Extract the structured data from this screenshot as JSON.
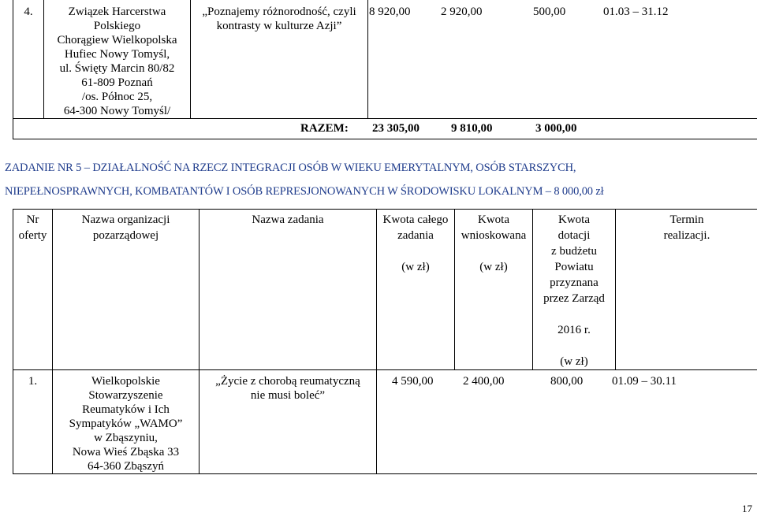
{
  "top_row": {
    "no": "4.",
    "org": "Związek Harcerstwa\nPolskiego\nChorągiew Wielkopolska\nHufiec Nowy Tomyśl,\nul. Święty Marcin 80/82\n61-809 Poznań\n/os. Północ 25,\n64-300 Nowy Tomyśl/",
    "task": "„Poznajemy różnorodność, czyli\nkontrasty w kulturze Azji”",
    "total_cost": "8 920,00",
    "requested": "2 920,00",
    "granted": "500,00",
    "term": "01.03 – 31.12"
  },
  "sum_row": {
    "label": "RAZEM:",
    "total_cost": "23 305,00",
    "requested": "9 810,00",
    "granted": "3 000,00"
  },
  "task5": {
    "line1": "ZADANIE NR 5 – DZIAŁALNOŚĆ NA RZECZ INTEGRACJI OSÓB W WIEKU EMERYTALNYM, OSÓB STARSZYCH,",
    "line2": "NIEPEŁNOSPRAWNYCH, KOMBATANTÓW I OSÓB REPRESJONOWANYCH W ŚRODOWISKU LOKALNYM – 8 000,00 zł"
  },
  "header": {
    "col1": "Nr\noferty",
    "col2": "Nazwa organizacji\npozarządowej",
    "col3": "Nazwa zadania",
    "col4": "Kwota całego\nzadania\n\n(w zł)",
    "col5": "Kwota\nwnioskowana\n\n(w zł)",
    "col6": "Kwota\ndotacji\nz budżetu\nPowiatu\nprzyznana\nprzez Zarząd\n\n2016 r.\n\n(w zł)",
    "col7": "Termin\nrealizacji."
  },
  "row1": {
    "no": "1.",
    "org": "Wielkopolskie\nStowarzyszenie\nReumatyków i Ich\nSympatyków „WAMO”\nw Zbąszyniu,\nNowa Wieś Zbąska 33\n64-360 Zbąszyń",
    "task": "„Życie z chorobą reumatyczną\nnie musi boleć”",
    "total_cost": "4 590,00",
    "requested": "2 400,00",
    "granted": "800,00",
    "term": "01.09 – 30.11"
  },
  "page_number": "17"
}
